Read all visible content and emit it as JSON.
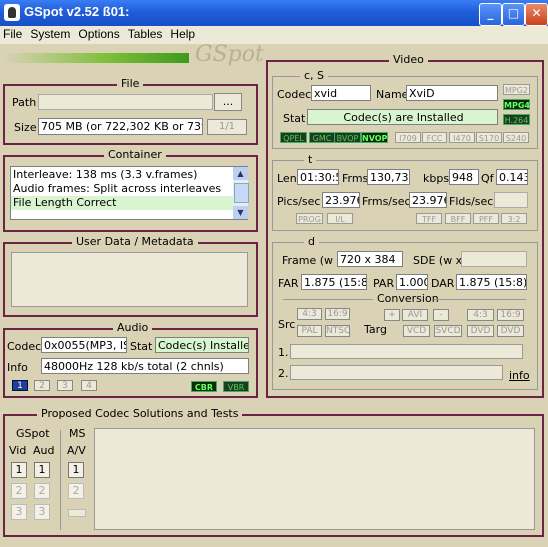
{
  "window": {
    "title": "GSpot v2.52 ß01:",
    "minimize": "_",
    "maximize": "□",
    "close": "✕"
  },
  "menu": [
    "File",
    "System",
    "Options",
    "Tables",
    "Help"
  ],
  "logo": "GSpot",
  "file": {
    "title": "File",
    "path_label": "Path",
    "path_value": "",
    "browse": "...",
    "size_label": "Size",
    "size_value": "705 MB (or 722,302 KB or 739,63",
    "page": "1/1"
  },
  "container": {
    "title": "Container",
    "lines": [
      "Interleave: 138 ms (3.3 v.frames)",
      "Audio frames: Split across interleaves",
      "File Length Correct"
    ]
  },
  "userdata": {
    "title": "User Data / Metadata"
  },
  "audio": {
    "title": "Audio",
    "codec_label": "Codec",
    "codec_value": "0x0055(MP3, ISO",
    "stat_label": "Stat",
    "stat_value": "Codec(s) Installed",
    "info_label": "Info",
    "info_value": "48000Hz  128 kb/s total (2 chnls)",
    "tracks": [
      "1",
      "2",
      "3",
      "4"
    ],
    "cbr": "CBR",
    "vbr": "VBR"
  },
  "video": {
    "title": "Video",
    "cs_title": "c, S",
    "codec_label": "Codec",
    "codec_value": "xvid",
    "name_label": "Name",
    "name_value": "XviD",
    "stat_label": "Stat",
    "stat_value": "Codec(s) are Installed",
    "fmt_badges": [
      "MPG2",
      "MPG4",
      "H.264"
    ],
    "flag_badges": [
      "QPEL",
      "GMC",
      "BVOP",
      "NVOP",
      "I709",
      "FCC",
      "I470",
      "S170",
      "S240"
    ],
    "t_title": "t",
    "len_label": "Len",
    "len_value": "01:30:5",
    "frms_label": "Frms",
    "frms_value": "130,738",
    "kbps_label": "kbps",
    "kbps_value": "948",
    "qf_label": "Qf",
    "qf_value": "0.143",
    "pics_label": "Pics/sec",
    "pics_value": "23.976",
    "frmssec_label": "Frms/sec",
    "frmssec_value": "23.976",
    "flds_label": "Flds/sec",
    "flds_value": "",
    "scan_badges": [
      "PROG",
      "I/L",
      "TFF",
      "BFF",
      "PFF",
      "3:2"
    ],
    "d_title": "d",
    "frame_label": "Frame (w x",
    "frame_value": "720 x 384",
    "sde_label": "SDE (w x",
    "sde_value": "",
    "far_label": "FAR",
    "far_value": "1.875 (15:8)",
    "par_label": "PAR",
    "par_value": "1.000",
    "dar_label": "DAR",
    "dar_value": "1.875 (15:8)",
    "conv_title": "Conversion",
    "src_label": "Src",
    "targ_label": "Targ",
    "src_btns": [
      "4:3",
      "16:9",
      "PAL",
      "NTSC"
    ],
    "targ_btns": [
      "+",
      "AVI",
      "-",
      "4:3",
      "16:9",
      "VCD",
      "SVCD",
      "DVD",
      "DVD"
    ],
    "row1": "1.",
    "row2": "2.",
    "info_link": "info"
  },
  "proposed": {
    "title": "Proposed Codec Solutions and Tests",
    "gspot_label": "GSpot",
    "ms_label": "MS",
    "vid_label": "Vid",
    "aud_label": "Aud",
    "av_label": "A/V",
    "nums": [
      "1",
      "2",
      "3"
    ]
  }
}
